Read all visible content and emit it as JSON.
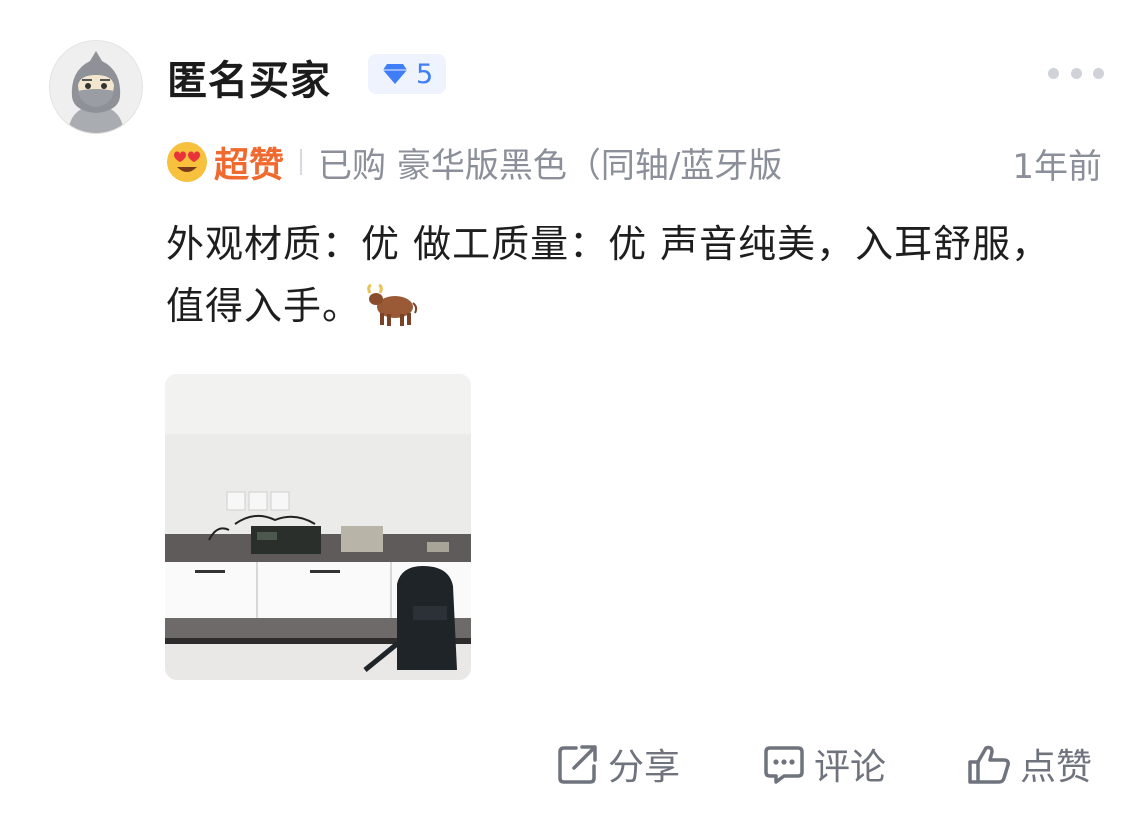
{
  "user": {
    "name": "匿名买家",
    "avatar_icon": "anonymous-ninja-avatar",
    "level": "5",
    "level_icon": "diamond-icon"
  },
  "meta": {
    "rating_icon": "heart-eyes-emoji",
    "rating": "超赞",
    "purchase": "已购 豪华版黑色（同轴/蓝牙版",
    "time": "1年前"
  },
  "review": {
    "text": "外观材质：优 做工质量：优 声音纯美，入耳舒服，值得入手。",
    "emoji_icon": "ox-emoji"
  },
  "photo": {
    "description_icon": "review-photo-tv-cabinet-audio-equipment"
  },
  "actions": {
    "share": "分享",
    "comment": "评论",
    "like": "点赞"
  },
  "colors": {
    "rating": "#f06a2f",
    "level": "#3f7ef6",
    "muted": "#8a8f99",
    "accent_bg": "#eef3fd"
  }
}
